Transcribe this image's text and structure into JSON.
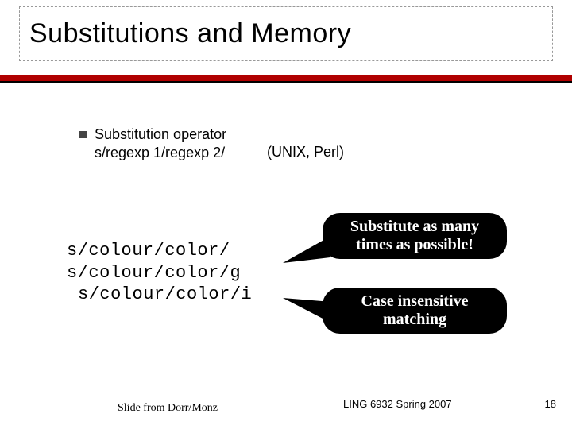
{
  "title": "Substitutions and Memory",
  "bullet": {
    "line1": "Substitution operator",
    "line2": "s/regexp 1/regexp 2/",
    "annotation": "(UNIX, Perl)"
  },
  "code": {
    "l1": "s/colour/color/",
    "l2": "s/colour/color/g",
    "l3": "s/colour/color/i"
  },
  "callout1": "Substitute as many times as possible!",
  "callout2": "Case insensitive matching",
  "footer": {
    "credit": "Slide from Dorr/Monz",
    "course": "LING 6932 Spring 2007",
    "page": "18"
  }
}
